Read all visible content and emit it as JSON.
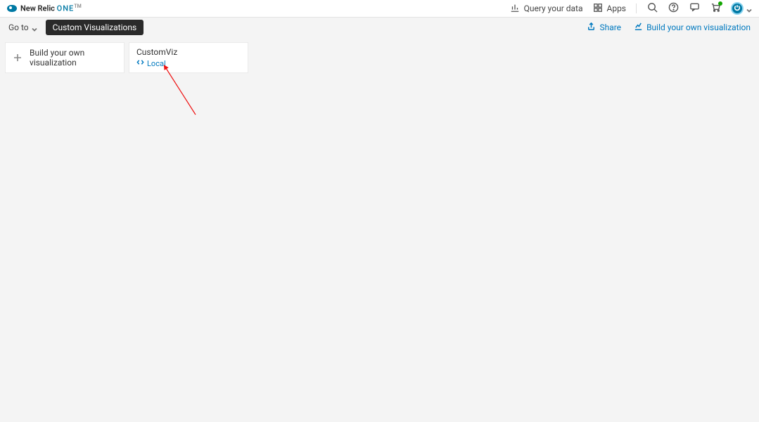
{
  "header": {
    "brand": {
      "main": "New Relic",
      "one": "ONE",
      "tm": "TM"
    },
    "query_label": "Query your data",
    "apps_label": "Apps"
  },
  "subheader": {
    "goto_label": "Go to",
    "pill_label": "Custom Visualizations",
    "share_label": "Share",
    "build_label": "Build your own visualization"
  },
  "cards": {
    "build": {
      "label": "Build your own visualization"
    },
    "viz": {
      "title": "CustomViz",
      "sub": "Local"
    }
  }
}
